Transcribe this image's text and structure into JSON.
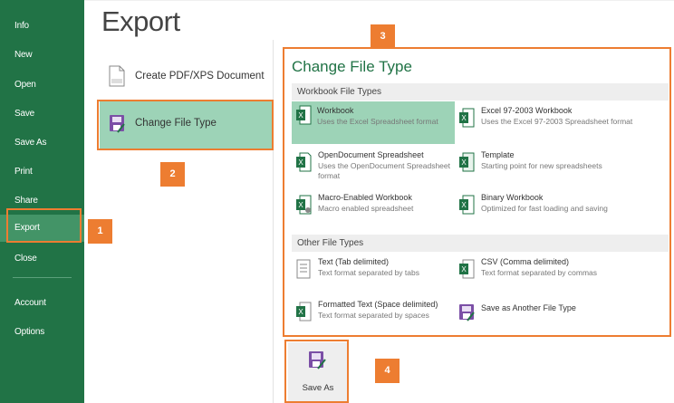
{
  "sidebar": {
    "items": [
      {
        "label": "Info"
      },
      {
        "label": "New"
      },
      {
        "label": "Open"
      },
      {
        "label": "Save"
      },
      {
        "label": "Save As"
      },
      {
        "label": "Print"
      },
      {
        "label": "Share"
      },
      {
        "label": "Export"
      },
      {
        "label": "Close"
      },
      {
        "label": "Account"
      },
      {
        "label": "Options"
      }
    ]
  },
  "main": {
    "title": "Export",
    "options": [
      {
        "label": "Create PDF/XPS Document"
      },
      {
        "label": "Change File Type"
      }
    ]
  },
  "change_file_type": {
    "title": "Change File Type",
    "workbook_section": "Workbook File Types",
    "other_section": "Other File Types",
    "workbook_types": [
      {
        "name": "Workbook",
        "desc": "Uses the Excel Spreadsheet format"
      },
      {
        "name": "Excel 97-2003 Workbook",
        "desc": "Uses the Excel 97-2003 Spreadsheet format"
      },
      {
        "name": "OpenDocument Spreadsheet",
        "desc": "Uses the OpenDocument Spreadsheet format"
      },
      {
        "name": "Template",
        "desc": "Starting point for new spreadsheets"
      },
      {
        "name": "Macro-Enabled Workbook",
        "desc": "Macro enabled spreadsheet"
      },
      {
        "name": "Binary Workbook",
        "desc": "Optimized for fast loading and saving"
      }
    ],
    "other_types": [
      {
        "name": "Text (Tab delimited)",
        "desc": "Text format separated by tabs"
      },
      {
        "name": "CSV (Comma delimited)",
        "desc": "Text format separated by commas"
      },
      {
        "name": "Formatted Text (Space delimited)",
        "desc": "Text format separated by spaces"
      },
      {
        "name": "Save as Another File Type",
        "desc": ""
      }
    ]
  },
  "save_as_button": {
    "label": "Save As"
  },
  "callouts": {
    "one": "1",
    "two": "2",
    "three": "3",
    "four": "4"
  },
  "colors": {
    "brand": "#217346",
    "accent": "#ed7d31",
    "selected": "#9dd3b7"
  }
}
